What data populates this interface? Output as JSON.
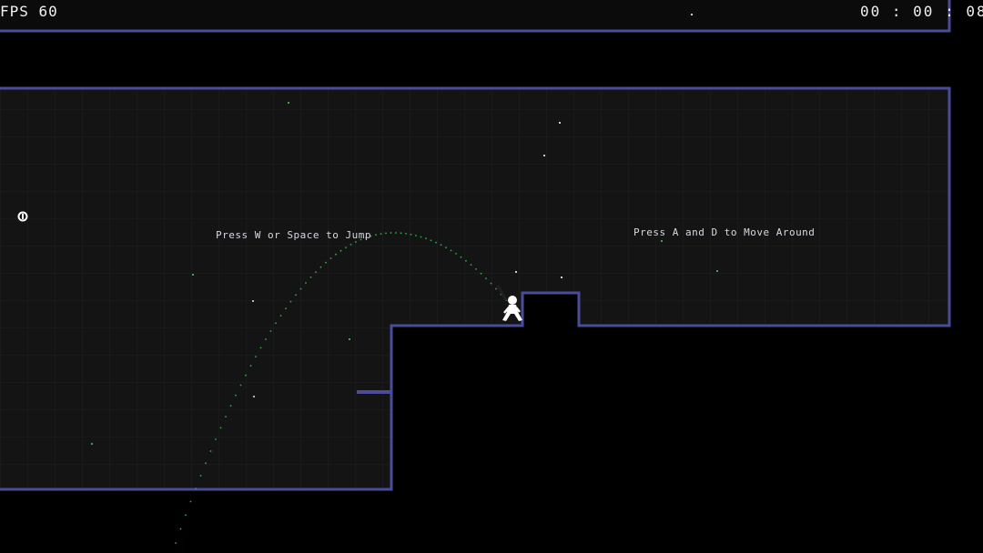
{
  "hud": {
    "fps_label": "FPS 60",
    "timer_label": "00 : 00 : 08"
  },
  "hints": {
    "jump": "Press W or Space to Jump",
    "move": "Press A and D to Move Around"
  },
  "colors": {
    "background": "#000000",
    "room_fill": "#141414",
    "grid_line": "#1f1f1f",
    "wall": "#4a4c9a",
    "trajectory": "#2fae46",
    "player": "#ffffff",
    "particle": "#c9c9f5"
  },
  "icons": {
    "player": "stick-figure-player-icon",
    "pickup": "coin-pickup-icon"
  }
}
